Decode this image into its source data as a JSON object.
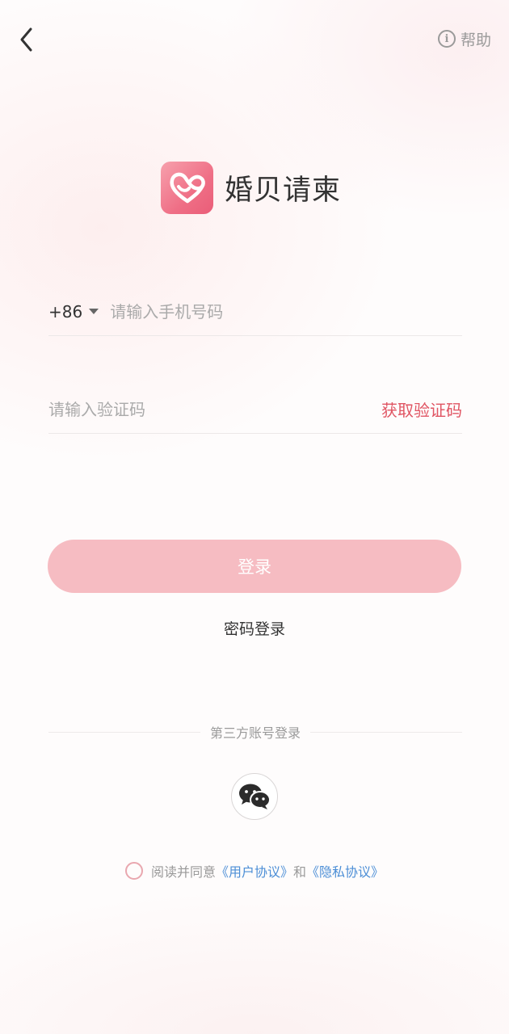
{
  "header": {
    "back_icon": "chevron-left-icon",
    "help_label": "帮助",
    "help_icon": "info-icon"
  },
  "brand": {
    "name": "婚贝请柬",
    "logo_icon": "heart-knot-icon",
    "logo_colors": [
      "#f7a1ad",
      "#ea5d78"
    ]
  },
  "phone": {
    "country_code": "+86",
    "placeholder": "请输入手机号码",
    "value": ""
  },
  "code": {
    "placeholder": "请输入验证码",
    "value": "",
    "get_code_label": "获取验证码"
  },
  "login": {
    "button_label": "登录",
    "password_login_label": "密码登录"
  },
  "third_party": {
    "title": "第三方账号登录",
    "wechat_icon": "wechat-icon"
  },
  "agreement": {
    "checked": false,
    "prefix": "阅读并同意",
    "user_agreement": "《用户协议》",
    "and": "和",
    "privacy_policy": "《隐私协议》"
  },
  "colors": {
    "accent": "#e05563",
    "login_button": "#f6bcc2",
    "link": "#4c8ed6"
  }
}
